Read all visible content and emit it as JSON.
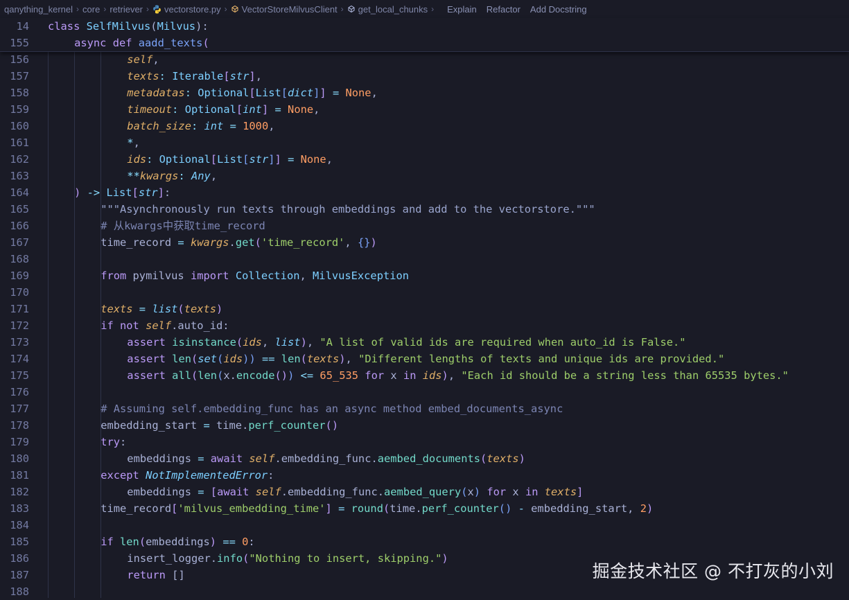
{
  "breadcrumb": {
    "items": [
      "qanything_kernel",
      "core",
      "retriever",
      "vectorstore.py",
      "VectorStoreMilvusClient",
      "get_local_chunks"
    ],
    "actions": [
      "Explain",
      "Refactor",
      "Add Docstring"
    ]
  },
  "editor": {
    "sticky_lines": [
      {
        "num": "14",
        "indent": 0,
        "tokens": [
          [
            "kw",
            "class "
          ],
          [
            "cls",
            "SelfMilvus"
          ],
          [
            "pn",
            "("
          ],
          [
            "cls",
            "Milvus"
          ],
          [
            "pn",
            "):"
          ]
        ]
      },
      {
        "num": "155",
        "indent": 1,
        "tokens": [
          [
            "kw",
            "async def "
          ],
          [
            "fn",
            "aadd_texts"
          ],
          [
            "br2",
            "("
          ]
        ]
      }
    ],
    "lines": [
      {
        "num": "156",
        "indent": 3,
        "tokens": [
          [
            "slf",
            "self"
          ],
          [
            "pn",
            ","
          ]
        ]
      },
      {
        "num": "157",
        "indent": 3,
        "tokens": [
          [
            "prm",
            "texts"
          ],
          [
            "op",
            ": "
          ],
          [
            "ty",
            "Iterable"
          ],
          [
            "br2",
            "["
          ],
          [
            "tyi",
            "str"
          ],
          [
            "br2",
            "]"
          ],
          [
            "pn",
            ","
          ]
        ]
      },
      {
        "num": "158",
        "indent": 3,
        "tokens": [
          [
            "prm",
            "metadatas"
          ],
          [
            "op",
            ": "
          ],
          [
            "ty",
            "Optional"
          ],
          [
            "br2",
            "["
          ],
          [
            "ty",
            "List"
          ],
          [
            "br3",
            "["
          ],
          [
            "tyi",
            "dict"
          ],
          [
            "br3",
            "]"
          ],
          [
            "br2",
            "]"
          ],
          [
            "op",
            " = "
          ],
          [
            "cst",
            "None"
          ],
          [
            "pn",
            ","
          ]
        ]
      },
      {
        "num": "159",
        "indent": 3,
        "tokens": [
          [
            "prm",
            "timeout"
          ],
          [
            "op",
            ": "
          ],
          [
            "ty",
            "Optional"
          ],
          [
            "br2",
            "["
          ],
          [
            "tyi",
            "int"
          ],
          [
            "br2",
            "]"
          ],
          [
            "op",
            " = "
          ],
          [
            "cst",
            "None"
          ],
          [
            "pn",
            ","
          ]
        ]
      },
      {
        "num": "160",
        "indent": 3,
        "tokens": [
          [
            "prm",
            "batch_size"
          ],
          [
            "op",
            ": "
          ],
          [
            "tyi",
            "int"
          ],
          [
            "op",
            " = "
          ],
          [
            "cst",
            "1000"
          ],
          [
            "pn",
            ","
          ]
        ]
      },
      {
        "num": "161",
        "indent": 3,
        "tokens": [
          [
            "op",
            "*"
          ],
          [
            "pn",
            ","
          ]
        ]
      },
      {
        "num": "162",
        "indent": 3,
        "tokens": [
          [
            "prm",
            "ids"
          ],
          [
            "op",
            ": "
          ],
          [
            "ty",
            "Optional"
          ],
          [
            "br2",
            "["
          ],
          [
            "ty",
            "List"
          ],
          [
            "br3",
            "["
          ],
          [
            "tyi",
            "str"
          ],
          [
            "br3",
            "]"
          ],
          [
            "br2",
            "]"
          ],
          [
            "op",
            " = "
          ],
          [
            "cst",
            "None"
          ],
          [
            "pn",
            ","
          ]
        ]
      },
      {
        "num": "163",
        "indent": 3,
        "tokens": [
          [
            "op",
            "**"
          ],
          [
            "prm",
            "kwargs"
          ],
          [
            "op",
            ": "
          ],
          [
            "tyi",
            "Any"
          ],
          [
            "pn",
            ","
          ]
        ]
      },
      {
        "num": "164",
        "indent": 1,
        "tokens": [
          [
            "br2",
            ")"
          ],
          [
            "op",
            " -> "
          ],
          [
            "ty",
            "List"
          ],
          [
            "br2",
            "["
          ],
          [
            "tyi",
            "str"
          ],
          [
            "br2",
            "]"
          ],
          [
            "pn",
            ":"
          ]
        ]
      },
      {
        "num": "165",
        "indent": 2,
        "tokens": [
          [
            "doc",
            "\"\"\"Asynchronously run texts through embeddings and add to the vectorstore.\"\"\""
          ]
        ]
      },
      {
        "num": "166",
        "indent": 2,
        "tokens": [
          [
            "cm",
            "# 从kwargs中获取time_record"
          ]
        ]
      },
      {
        "num": "167",
        "indent": 2,
        "tokens": [
          [
            "pn",
            "time_record "
          ],
          [
            "op",
            "= "
          ],
          [
            "prm",
            "kwargs"
          ],
          [
            "pn",
            "."
          ],
          [
            "mc",
            "get"
          ],
          [
            "br2",
            "("
          ],
          [
            "st",
            "'time_record'"
          ],
          [
            "pn",
            ", "
          ],
          [
            "br3",
            "{}"
          ],
          [
            "br2",
            ")"
          ]
        ]
      },
      {
        "num": "168",
        "indent": 0,
        "tokens": []
      },
      {
        "num": "169",
        "indent": 2,
        "tokens": [
          [
            "kw",
            "from "
          ],
          [
            "pn",
            "pymilvus "
          ],
          [
            "kw",
            "import "
          ],
          [
            "cls",
            "Collection"
          ],
          [
            "pn",
            ", "
          ],
          [
            "cls",
            "MilvusException"
          ]
        ]
      },
      {
        "num": "170",
        "indent": 0,
        "tokens": []
      },
      {
        "num": "171",
        "indent": 2,
        "tokens": [
          [
            "prm",
            "texts"
          ],
          [
            "op",
            " = "
          ],
          [
            "tyi",
            "list"
          ],
          [
            "br2",
            "("
          ],
          [
            "prm",
            "texts"
          ],
          [
            "br2",
            ")"
          ]
        ]
      },
      {
        "num": "172",
        "indent": 2,
        "tokens": [
          [
            "kw",
            "if not "
          ],
          [
            "slf",
            "self"
          ],
          [
            "pn",
            ".auto_id:"
          ]
        ]
      },
      {
        "num": "173",
        "indent": 3,
        "tokens": [
          [
            "kw",
            "assert "
          ],
          [
            "mc",
            "isinstance"
          ],
          [
            "br2",
            "("
          ],
          [
            "prm",
            "ids"
          ],
          [
            "pn",
            ", "
          ],
          [
            "tyi",
            "list"
          ],
          [
            "br2",
            ")"
          ],
          [
            "pn",
            ", "
          ],
          [
            "st",
            "\"A list of valid ids are required when auto_id is False.\""
          ]
        ]
      },
      {
        "num": "174",
        "indent": 3,
        "tokens": [
          [
            "kw",
            "assert "
          ],
          [
            "mc",
            "len"
          ],
          [
            "br2",
            "("
          ],
          [
            "tyi",
            "set"
          ],
          [
            "br3",
            "("
          ],
          [
            "prm",
            "ids"
          ],
          [
            "br3",
            "))"
          ],
          [
            "op",
            " == "
          ],
          [
            "mc",
            "len"
          ],
          [
            "br2",
            "("
          ],
          [
            "prm",
            "texts"
          ],
          [
            "br2",
            ")"
          ],
          [
            "pn",
            ", "
          ],
          [
            "st",
            "\"Different lengths of texts and unique ids are provided.\""
          ]
        ]
      },
      {
        "num": "175",
        "indent": 3,
        "tokens": [
          [
            "kw",
            "assert "
          ],
          [
            "mc",
            "all"
          ],
          [
            "br2",
            "("
          ],
          [
            "mc",
            "len"
          ],
          [
            "br3",
            "("
          ],
          [
            "pn",
            "x."
          ],
          [
            "mc",
            "encode"
          ],
          [
            "br2",
            "()"
          ],
          [
            "br3",
            ")"
          ],
          [
            "op",
            " <= "
          ],
          [
            "cst",
            "65_535"
          ],
          [
            "kw",
            " for "
          ],
          [
            "pn",
            "x "
          ],
          [
            "kw",
            "in "
          ],
          [
            "prm",
            "ids"
          ],
          [
            "br2",
            ")"
          ],
          [
            "pn",
            ", "
          ],
          [
            "st",
            "\"Each id should be a string less than 65535 bytes.\""
          ]
        ]
      },
      {
        "num": "176",
        "indent": 0,
        "tokens": []
      },
      {
        "num": "177",
        "indent": 2,
        "tokens": [
          [
            "cm",
            "# Assuming self.embedding_func has an async method embed_documents_async"
          ]
        ]
      },
      {
        "num": "178",
        "indent": 2,
        "tokens": [
          [
            "pn",
            "embedding_start "
          ],
          [
            "op",
            "= "
          ],
          [
            "pn",
            "time."
          ],
          [
            "mc",
            "perf_counter"
          ],
          [
            "br2",
            "()"
          ]
        ]
      },
      {
        "num": "179",
        "indent": 2,
        "tokens": [
          [
            "kw",
            "try"
          ],
          [
            "pn",
            ":"
          ]
        ]
      },
      {
        "num": "180",
        "indent": 3,
        "tokens": [
          [
            "pn",
            "embeddings "
          ],
          [
            "op",
            "= "
          ],
          [
            "kw",
            "await "
          ],
          [
            "slf",
            "self"
          ],
          [
            "pn",
            ".embedding_func."
          ],
          [
            "mc",
            "aembed_documents"
          ],
          [
            "br2",
            "("
          ],
          [
            "prm",
            "texts"
          ],
          [
            "br2",
            ")"
          ]
        ]
      },
      {
        "num": "181",
        "indent": 2,
        "tokens": [
          [
            "kw",
            "except "
          ],
          [
            "tyi",
            "NotImplementedError"
          ],
          [
            "pn",
            ":"
          ]
        ]
      },
      {
        "num": "182",
        "indent": 3,
        "tokens": [
          [
            "pn",
            "embeddings "
          ],
          [
            "op",
            "= "
          ],
          [
            "br2",
            "["
          ],
          [
            "kw",
            "await "
          ],
          [
            "slf",
            "self"
          ],
          [
            "pn",
            ".embedding_func."
          ],
          [
            "mc",
            "aembed_query"
          ],
          [
            "br3",
            "("
          ],
          [
            "pn",
            "x"
          ],
          [
            "br3",
            ")"
          ],
          [
            "kw",
            " for "
          ],
          [
            "pn",
            "x "
          ],
          [
            "kw",
            "in "
          ],
          [
            "prm",
            "texts"
          ],
          [
            "br2",
            "]"
          ]
        ]
      },
      {
        "num": "183",
        "indent": 2,
        "tokens": [
          [
            "pn",
            "time_record"
          ],
          [
            "br2",
            "["
          ],
          [
            "st",
            "'milvus_embedding_time'"
          ],
          [
            "br2",
            "]"
          ],
          [
            "op",
            " = "
          ],
          [
            "mc",
            "round"
          ],
          [
            "br2",
            "("
          ],
          [
            "pn",
            "time."
          ],
          [
            "mc",
            "perf_counter"
          ],
          [
            "br3",
            "()"
          ],
          [
            "op",
            " - "
          ],
          [
            "pn",
            "embedding_start, "
          ],
          [
            "cst",
            "2"
          ],
          [
            "br2",
            ")"
          ]
        ]
      },
      {
        "num": "184",
        "indent": 0,
        "tokens": []
      },
      {
        "num": "185",
        "indent": 2,
        "tokens": [
          [
            "kw",
            "if "
          ],
          [
            "mc",
            "len"
          ],
          [
            "br2",
            "("
          ],
          [
            "pn",
            "embeddings"
          ],
          [
            "br2",
            ")"
          ],
          [
            "op",
            " == "
          ],
          [
            "cst",
            "0"
          ],
          [
            "pn",
            ":"
          ]
        ]
      },
      {
        "num": "186",
        "indent": 3,
        "tokens": [
          [
            "pn",
            "insert_logger."
          ],
          [
            "mc",
            "info"
          ],
          [
            "br2",
            "("
          ],
          [
            "st",
            "\"Nothing to insert, skipping.\""
          ],
          [
            "br2",
            ")"
          ]
        ]
      },
      {
        "num": "187",
        "indent": 3,
        "tokens": [
          [
            "kw",
            "return "
          ],
          [
            "pn",
            "[]"
          ]
        ]
      },
      {
        "num": "188",
        "indent": 0,
        "tokens": []
      }
    ]
  },
  "watermark": "掘金技术社区 @ 不打灰的小刘"
}
